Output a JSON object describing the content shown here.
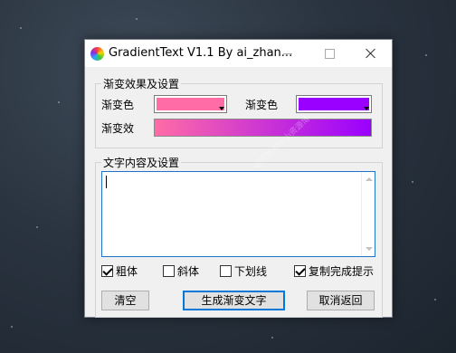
{
  "window": {
    "title": "GradientText V1.1 By ai_zhan...",
    "app_icon": "rainbow-circle-icon"
  },
  "effects": {
    "group_label": "渐变效果及设置",
    "color1_label": "渐变色",
    "color1": "#ff6ca6",
    "color2_label": "渐变色",
    "color2": "#9a00ff",
    "preview_label": "渐变效"
  },
  "content": {
    "group_label": "文字内容及设置",
    "text_value": ""
  },
  "options": [
    {
      "label": "粗体",
      "checked": true
    },
    {
      "label": "斜体",
      "checked": false
    },
    {
      "label": "下划线",
      "checked": false
    },
    {
      "label": "复制完成提示",
      "checked": true
    }
  ],
  "buttons": {
    "clear": "清空",
    "generate": "生成渐变文字",
    "cancel": "取消返回"
  },
  "watermarks": {
    "site": "www.xxziyuan.top",
    "search": "必应搜索小小资源博"
  }
}
